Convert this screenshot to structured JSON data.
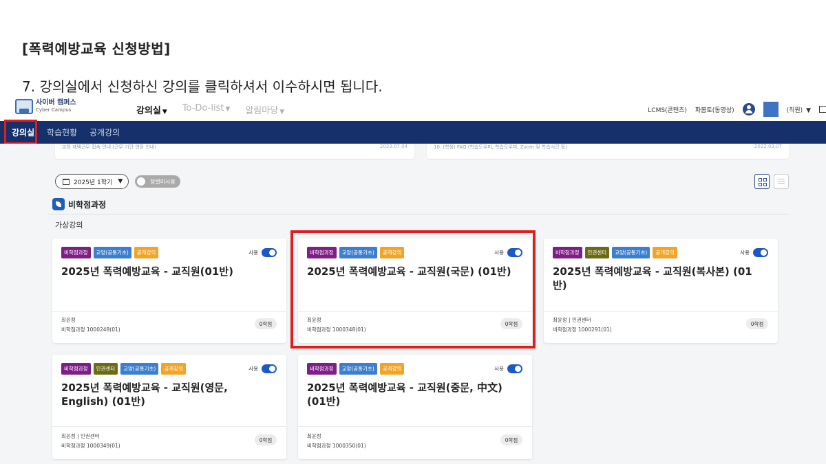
{
  "slide": {
    "title": "[폭력예방교육 신청방법]",
    "step": "7. 강의실에서 신청하신 강의를 클릭하셔서 이수하시면 됩니다."
  },
  "header": {
    "logo_main": "사이버 캠퍼스",
    "logo_sub": "Cyber Campus",
    "nav": [
      {
        "label": "강의실"
      },
      {
        "label": "To-Do-list"
      },
      {
        "label": "알림마당"
      }
    ],
    "right": {
      "lcms": "LCMS(콘텐츠)",
      "pub": "파봄토(동영상)",
      "role": "(직원)"
    }
  },
  "subnav": {
    "items": [
      {
        "label": "강의실"
      },
      {
        "label": "학습현황"
      },
      {
        "label": "공개강의"
      }
    ]
  },
  "notices": [
    {
      "title": "교외 재택근무 접속 안내 (근무 기간 연장 안내)",
      "date": "2023.07.04"
    },
    {
      "title": "10. (학생) FAQ (학습도우미, 학습도우미, Zoom 및 학습시간 등)",
      "date": "2022.03.07"
    }
  ],
  "filters": {
    "semester": "2025년 1학기",
    "toggle_label": "정렬미사용"
  },
  "section": {
    "title": "비학점과정",
    "subtitle": "가상강의"
  },
  "courses": [
    {
      "tags": [
        {
          "label": "비학점과정",
          "color": "#7e1f86"
        },
        {
          "label": "교양(공통기초)",
          "color": "#3d7fcf"
        },
        {
          "label": "공개강의",
          "color": "#f2a427"
        }
      ],
      "use_label": "사용",
      "title": "2025년 폭력예방교육 - 교직원(01반)",
      "professor": "최윤정",
      "code": "비학점과정 1000248(01)",
      "credit": "0학점"
    },
    {
      "tags": [
        {
          "label": "비학점과정",
          "color": "#7e1f86"
        },
        {
          "label": "교양(공통기초)",
          "color": "#3d7fcf"
        },
        {
          "label": "공개강의",
          "color": "#f2a427"
        }
      ],
      "use_label": "사용",
      "title": "2025년 폭력예방교육 - 교직원(국문) (01반)",
      "professor": "최윤정",
      "code": "비학점과정 1000348(01)",
      "credit": "0학점"
    },
    {
      "tags": [
        {
          "label": "비학점과정",
          "color": "#7e1f86"
        },
        {
          "label": "인권센터",
          "color": "#6b6b14"
        },
        {
          "label": "교양(공통기초)",
          "color": "#3d7fcf"
        },
        {
          "label": "공개강의",
          "color": "#f2a427"
        }
      ],
      "use_label": "사용",
      "title": "2025년 폭력예방교육 - 교직원(복사본) (01반)",
      "professor": "최윤정 | 인권센터",
      "code": "비학점과정 1000291(01)",
      "credit": "0학점"
    },
    {
      "tags": [
        {
          "label": "비학점과정",
          "color": "#7e1f86"
        },
        {
          "label": "인권센터",
          "color": "#6b6b14"
        },
        {
          "label": "교양(공통기초)",
          "color": "#3d7fcf"
        },
        {
          "label": "공개강의",
          "color": "#f2a427"
        }
      ],
      "use_label": "사용",
      "title": "2025년 폭력예방교육 - 교직원(영문, English) (01반)",
      "professor": "최윤정 | 인권센터",
      "code": "비학점과정 1000349(01)",
      "credit": "0학점"
    },
    {
      "tags": [
        {
          "label": "비학점과정",
          "color": "#7e1f86"
        },
        {
          "label": "교양(공통기초)",
          "color": "#3d7fcf"
        },
        {
          "label": "공개강의",
          "color": "#f2a427"
        }
      ],
      "use_label": "사용",
      "title": "2025년 폭력예방교육 - 교직원(중문, 中文) (01반)",
      "professor": "최윤정",
      "code": "비학점과정 1000350(01)",
      "credit": "0학점"
    }
  ],
  "colors": {
    "navbar": "#15306a",
    "highlight": "#e01e1e",
    "switch_on": "#1d59c6"
  }
}
